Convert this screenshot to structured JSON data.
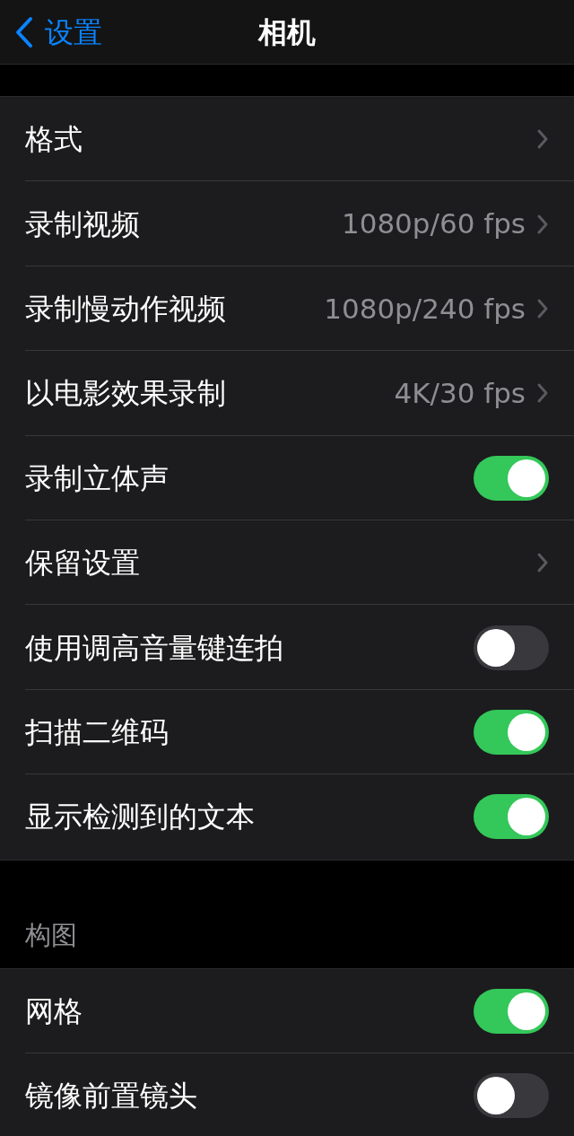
{
  "nav": {
    "back": "设置",
    "title": "相机"
  },
  "groups": [
    {
      "rows": [
        {
          "kind": "link",
          "label": "格式"
        },
        {
          "kind": "link",
          "label": "录制视频",
          "value": "1080p/60 fps"
        },
        {
          "kind": "link",
          "label": "录制慢动作视频",
          "value": "1080p/240 fps"
        },
        {
          "kind": "link",
          "label": "以电影效果录制",
          "value": "4K/30 fps"
        },
        {
          "kind": "toggle",
          "label": "录制立体声",
          "on": true
        },
        {
          "kind": "link",
          "label": "保留设置"
        },
        {
          "kind": "toggle",
          "label": "使用调高音量键连拍",
          "on": false
        },
        {
          "kind": "toggle",
          "label": "扫描二维码",
          "on": true
        },
        {
          "kind": "toggle",
          "label": "显示检测到的文本",
          "on": true
        }
      ]
    },
    {
      "header": "构图",
      "rows": [
        {
          "kind": "toggle",
          "label": "网格",
          "on": true
        },
        {
          "kind": "toggle",
          "label": "镜像前置镜头",
          "on": false
        }
      ]
    }
  ]
}
